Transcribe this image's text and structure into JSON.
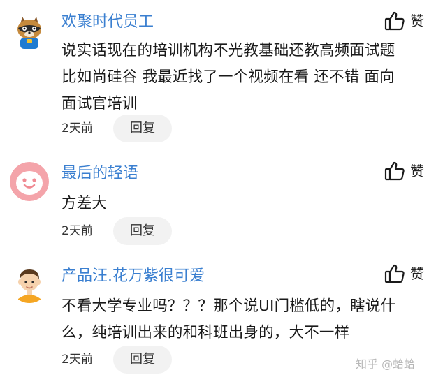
{
  "like_label": "赞",
  "reply_label": "回复",
  "comments": [
    {
      "username": "欢聚时代员工",
      "content_lines": [
        "说实话现在的培训机构不光教基础还教高频面试题",
        "比如尚硅谷 我最近找了一个视频在看 还不错 面向",
        "面试官培训"
      ],
      "time": "2天前",
      "avatar": "raccoon-avatar"
    },
    {
      "username": "最后的轻语",
      "content_lines": [
        "方差大"
      ],
      "time": "2天前",
      "avatar": "smiley-face-avatar"
    },
    {
      "username": "产品汪.花万紫很可爱",
      "content_lines": [
        "不看大学专业吗？？？那个说UI门槛低的，瞎说什",
        "么，纯培训出来的和科班出身的，大不一样"
      ],
      "time": "2天前",
      "avatar": "cartoon-man-avatar"
    }
  ],
  "watermark": "知乎 @蛤蛤",
  "colors": {
    "username": "#3a7fd0",
    "reply_bg": "#f2f2f2",
    "accent_pink": "#f4a4aa"
  }
}
